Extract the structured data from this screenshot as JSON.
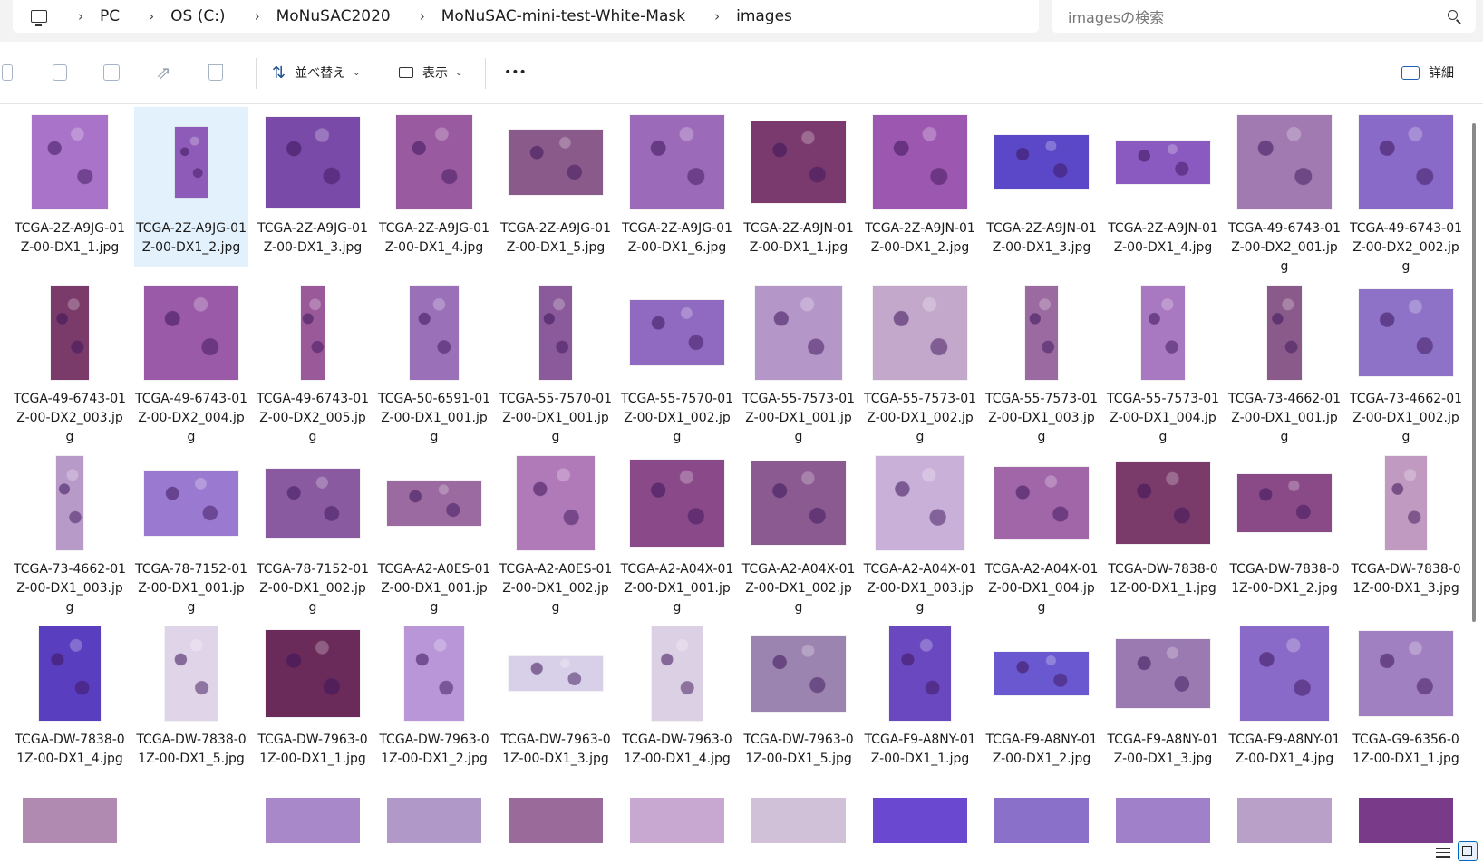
{
  "address": {
    "crumbs": [
      "PC",
      "OS (C:)",
      "MoNuSAC2020",
      "MoNuSAC-mini-test-White-Mask",
      "images"
    ]
  },
  "search": {
    "placeholder": "imagesの検索"
  },
  "toolbar": {
    "sort_label": "並べ替え",
    "view_label": "表示",
    "more_label": "•••",
    "details_label": "詳細"
  },
  "files": [
    {
      "name": "TCGA-2Z-A9JG-01Z-00-DX1_1.jpg",
      "w": 84,
      "h": 104,
      "color": "#a873c8",
      "selected": false
    },
    {
      "name": "TCGA-2Z-A9JG-01Z-00-DX1_2.jpg",
      "w": 36,
      "h": 78,
      "color": "#8e5cb8",
      "selected": true
    },
    {
      "name": "TCGA-2Z-A9JG-01Z-00-DX1_3.jpg",
      "w": 104,
      "h": 100,
      "color": "#7a4aa8",
      "selected": false
    },
    {
      "name": "TCGA-2Z-A9JG-01Z-00-DX1_4.jpg",
      "w": 84,
      "h": 104,
      "color": "#9a5aa0",
      "selected": false
    },
    {
      "name": "TCGA-2Z-A9JG-01Z-00-DX1_5.jpg",
      "w": 104,
      "h": 72,
      "color": "#8a5a8a",
      "selected": false
    },
    {
      "name": "TCGA-2Z-A9JG-01Z-00-DX1_6.jpg",
      "w": 104,
      "h": 104,
      "color": "#9b6ab8",
      "selected": false
    },
    {
      "name": "TCGA-2Z-A9JN-01Z-00-DX1_1.jpg",
      "w": 104,
      "h": 90,
      "color": "#7a3a6e",
      "selected": false
    },
    {
      "name": "TCGA-2Z-A9JN-01Z-00-DX1_2.jpg",
      "w": 104,
      "h": 104,
      "color": "#9c58b0",
      "selected": false
    },
    {
      "name": "TCGA-2Z-A9JN-01Z-00-DX1_3.jpg",
      "w": 104,
      "h": 60,
      "color": "#5a48c8",
      "selected": false
    },
    {
      "name": "TCGA-2Z-A9JN-01Z-00-DX1_4.jpg",
      "w": 104,
      "h": 48,
      "color": "#8a5ac0",
      "selected": false
    },
    {
      "name": "TCGA-49-6743-01Z-00-DX2_001.jpg",
      "w": 104,
      "h": 104,
      "color": "#a07ab0",
      "selected": false
    },
    {
      "name": "TCGA-49-6743-01Z-00-DX2_002.jpg",
      "w": 104,
      "h": 104,
      "color": "#8a6ac8",
      "selected": false
    },
    {
      "name": "TCGA-49-6743-01Z-00-DX2_003.jpg",
      "w": 42,
      "h": 104,
      "color": "#7a3a6a",
      "selected": false
    },
    {
      "name": "TCGA-49-6743-01Z-00-DX2_004.jpg",
      "w": 104,
      "h": 104,
      "color": "#9a5aa8",
      "selected": false
    },
    {
      "name": "TCGA-49-6743-01Z-00-DX2_005.jpg",
      "w": 26,
      "h": 104,
      "color": "#9a5a9a",
      "selected": false
    },
    {
      "name": "TCGA-50-6591-01Z-00-DX1_001.jpg",
      "w": 54,
      "h": 104,
      "color": "#9a70b8",
      "selected": false
    },
    {
      "name": "TCGA-55-7570-01Z-00-DX1_001.jpg",
      "w": 36,
      "h": 104,
      "color": "#8a5a9a",
      "selected": false
    },
    {
      "name": "TCGA-55-7570-01Z-00-DX1_002.jpg",
      "w": 104,
      "h": 72,
      "color": "#8f6ac0",
      "selected": false
    },
    {
      "name": "TCGA-55-7573-01Z-00-DX1_001.jpg",
      "w": 96,
      "h": 104,
      "color": "#b596c8",
      "selected": false
    },
    {
      "name": "TCGA-55-7573-01Z-00-DX1_002.jpg",
      "w": 104,
      "h": 104,
      "color": "#c4a8cc",
      "selected": false
    },
    {
      "name": "TCGA-55-7573-01Z-00-DX1_003.jpg",
      "w": 36,
      "h": 104,
      "color": "#9a6aa0",
      "selected": false
    },
    {
      "name": "TCGA-55-7573-01Z-00-DX1_004.jpg",
      "w": 48,
      "h": 104,
      "color": "#a878c0",
      "selected": false
    },
    {
      "name": "TCGA-73-4662-01Z-00-DX1_001.jpg",
      "w": 38,
      "h": 104,
      "color": "#8a5a8a",
      "selected": false
    },
    {
      "name": "TCGA-73-4662-01Z-00-DX1_002.jpg",
      "w": 104,
      "h": 96,
      "color": "#8e72c8",
      "selected": false
    },
    {
      "name": "TCGA-73-4662-01Z-00-DX1_003.jpg",
      "w": 30,
      "h": 104,
      "color": "#b89ac8",
      "selected": false
    },
    {
      "name": "TCGA-78-7152-01Z-00-DX1_001.jpg",
      "w": 104,
      "h": 72,
      "color": "#9a7ad0",
      "selected": false
    },
    {
      "name": "TCGA-78-7152-01Z-00-DX1_002.jpg",
      "w": 104,
      "h": 76,
      "color": "#8a5aa0",
      "selected": false
    },
    {
      "name": "TCGA-A2-A0ES-01Z-00-DX1_001.jpg",
      "w": 104,
      "h": 50,
      "color": "#9a6aa0",
      "selected": false
    },
    {
      "name": "TCGA-A2-A0ES-01Z-00-DX1_002.jpg",
      "w": 86,
      "h": 104,
      "color": "#b07ab8",
      "selected": false
    },
    {
      "name": "TCGA-A2-A04X-01Z-00-DX1_001.jpg",
      "w": 104,
      "h": 96,
      "color": "#8a4a8a",
      "selected": false
    },
    {
      "name": "TCGA-A2-A04X-01Z-00-DX1_002.jpg",
      "w": 104,
      "h": 92,
      "color": "#8a5a90",
      "selected": false
    },
    {
      "name": "TCGA-A2-A04X-01Z-00-DX1_003.jpg",
      "w": 98,
      "h": 104,
      "color": "#c8b0d8",
      "selected": false
    },
    {
      "name": "TCGA-A2-A04X-01Z-00-DX1_004.jpg",
      "w": 104,
      "h": 80,
      "color": "#a066a8",
      "selected": false
    },
    {
      "name": "TCGA-DW-7838-01Z-00-DX1_1.jpg",
      "w": 104,
      "h": 90,
      "color": "#7a3a6a",
      "selected": false
    },
    {
      "name": "TCGA-DW-7838-01Z-00-DX1_2.jpg",
      "w": 104,
      "h": 64,
      "color": "#8a4a88",
      "selected": false
    },
    {
      "name": "TCGA-DW-7838-01Z-00-DX1_3.jpg",
      "w": 46,
      "h": 104,
      "color": "#c09ac0",
      "selected": false
    },
    {
      "name": "TCGA-DW-7838-01Z-00-DX1_4.jpg",
      "w": 68,
      "h": 104,
      "color": "#5a3ec0",
      "selected": false
    },
    {
      "name": "TCGA-DW-7838-01Z-00-DX1_5.jpg",
      "w": 58,
      "h": 104,
      "color": "#e0d4e8",
      "selected": false
    },
    {
      "name": "TCGA-DW-7963-01Z-00-DX1_1.jpg",
      "w": 104,
      "h": 96,
      "color": "#6a2a5a",
      "selected": false
    },
    {
      "name": "TCGA-DW-7963-01Z-00-DX1_2.jpg",
      "w": 66,
      "h": 104,
      "color": "#b896d8",
      "selected": false
    },
    {
      "name": "TCGA-DW-7963-01Z-00-DX1_3.jpg",
      "w": 104,
      "h": 38,
      "color": "#d8d0e8",
      "selected": false
    },
    {
      "name": "TCGA-DW-7963-01Z-00-DX1_4.jpg",
      "w": 56,
      "h": 104,
      "color": "#dcd0e4",
      "selected": false
    },
    {
      "name": "TCGA-DW-7963-01Z-00-DX1_5.jpg",
      "w": 104,
      "h": 84,
      "color": "#9c84b0",
      "selected": false
    },
    {
      "name": "TCGA-F9-A8NY-01Z-00-DX1_1.jpg",
      "w": 68,
      "h": 104,
      "color": "#6a48c0",
      "selected": false
    },
    {
      "name": "TCGA-F9-A8NY-01Z-00-DX1_2.jpg",
      "w": 104,
      "h": 48,
      "color": "#6a58d0",
      "selected": false
    },
    {
      "name": "TCGA-F9-A8NY-01Z-00-DX1_3.jpg",
      "w": 104,
      "h": 76,
      "color": "#9a7ab0",
      "selected": false
    },
    {
      "name": "TCGA-F9-A8NY-01Z-00-DX1_4.jpg",
      "w": 98,
      "h": 104,
      "color": "#8a6ac8",
      "selected": false
    },
    {
      "name": "TCGA-G9-6356-01Z-00-DX1_1.jpg",
      "w": 104,
      "h": 94,
      "color": "#a080c0",
      "selected": false
    }
  ],
  "partial_row_colors": [
    "#b08ab0",
    "#ffffff",
    "#a888c8",
    "#b098c8",
    "#9a6a9a",
    "#c8a8d0",
    "#d0c0d8",
    "#6a48d0",
    "#8a70c8",
    "#a080c8",
    "#b8a0c8",
    "#7a3a8a"
  ]
}
